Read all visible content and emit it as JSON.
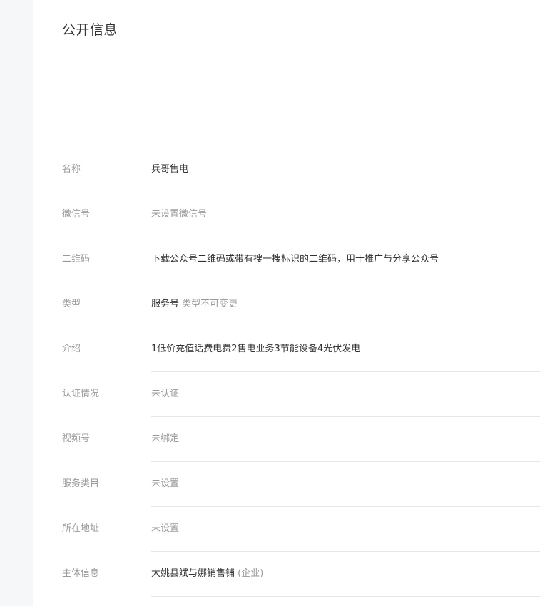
{
  "page": {
    "title": "公开信息"
  },
  "rows": [
    {
      "label": "名称",
      "value": "兵哥售电"
    },
    {
      "label": "微信号",
      "value": "未设置微信号"
    },
    {
      "label": "二维码",
      "value": "下载公众号二维码或带有搜一搜标识的二维码，用于推广与分享公众号"
    },
    {
      "label": "类型",
      "value": "服务号",
      "note": "类型不可变更"
    },
    {
      "label": "介绍",
      "value": "1低价充值话费电费2售电业务3节能设备4光伏发电"
    },
    {
      "label": "认证情况",
      "value": "未认证"
    },
    {
      "label": "视频号",
      "value": "未绑定"
    },
    {
      "label": "服务类目",
      "value": "未设置"
    },
    {
      "label": "所在地址",
      "value": "未设置"
    },
    {
      "label": "主体信息",
      "value": "大姚县斌与娜销售铺",
      "note": "(企业)"
    }
  ]
}
